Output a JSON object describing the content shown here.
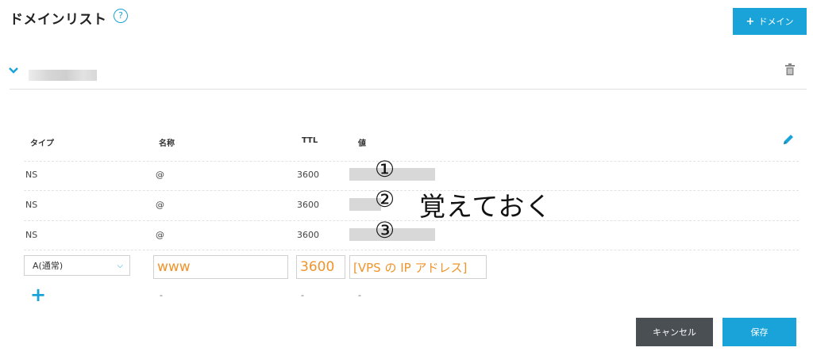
{
  "header": {
    "title": "ドメインリスト",
    "help_icon": "?",
    "add_domain_plus": "+",
    "add_domain_label": "ドメイン"
  },
  "table": {
    "headers": {
      "type": "タイプ",
      "name": "名称",
      "ttl": "TTL",
      "value": "値"
    },
    "rows": [
      {
        "type": "NS",
        "name": "@",
        "ttl": "3600"
      },
      {
        "type": "NS",
        "name": "@",
        "ttl": "3600"
      },
      {
        "type": "NS",
        "name": "@",
        "ttl": "3600"
      }
    ]
  },
  "annotations": {
    "mark1": "①",
    "mark2": "②",
    "mark3": "③",
    "note": "覚えておく"
  },
  "new_record": {
    "type_selected": "A(通常)",
    "name_value": "www",
    "ttl_value": "3600",
    "value_value": "[VPS の IP アドレス]",
    "add_plus": "+",
    "dash_name": "-",
    "dash_ttl": "-",
    "dash_value": "-"
  },
  "footer": {
    "cancel_label": "キャンセル",
    "save_label": "保存"
  },
  "colors": {
    "accent": "#1aa3d8",
    "cancel_bg": "#4a4f54",
    "input_text": "#f0932b"
  },
  "icons": [
    "help-icon",
    "plus-icon",
    "chevron-down-icon",
    "trash-icon",
    "pencil-icon"
  ]
}
